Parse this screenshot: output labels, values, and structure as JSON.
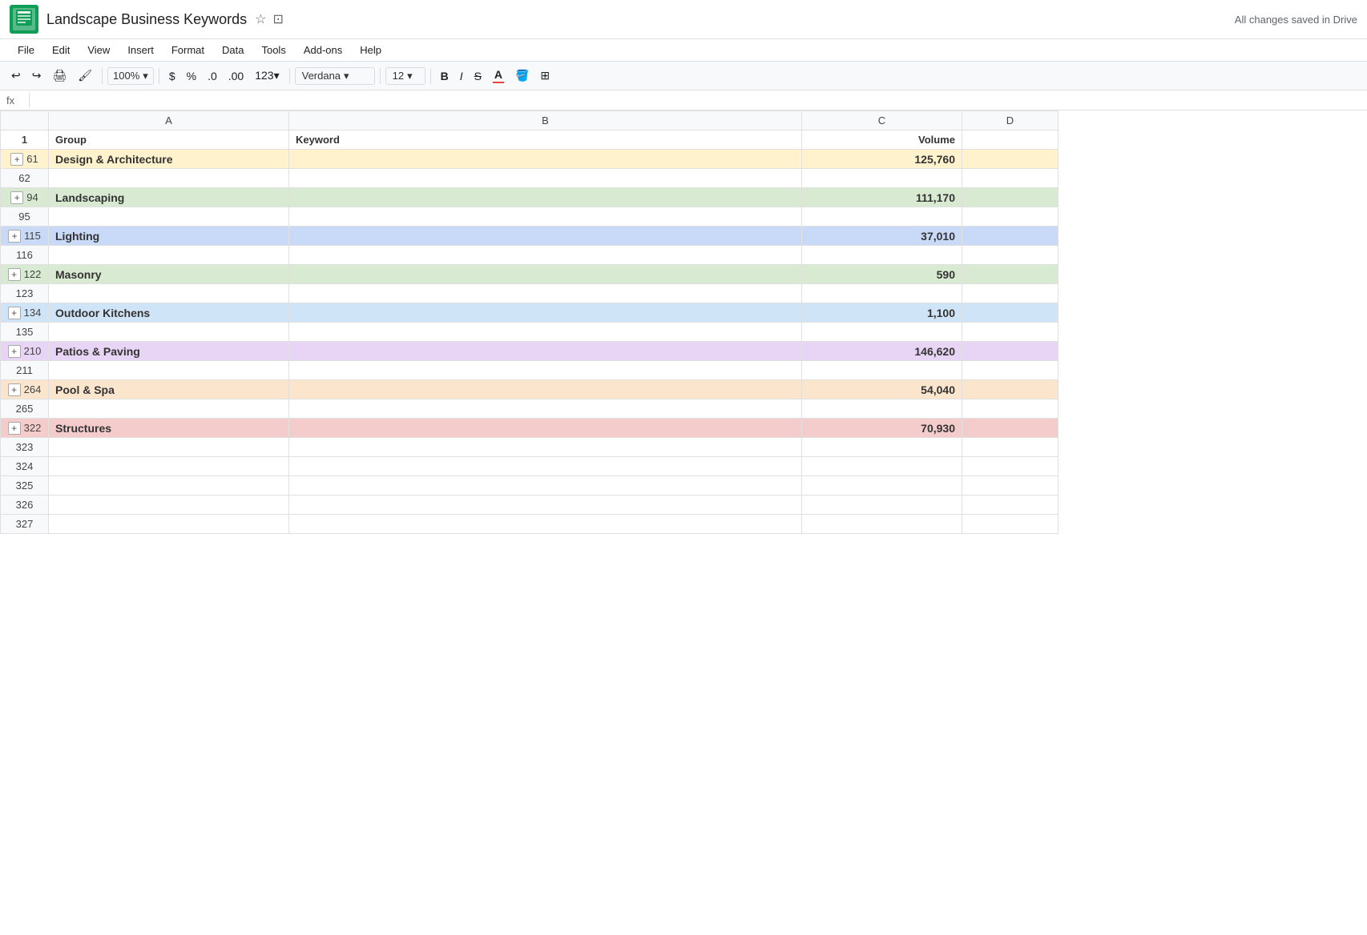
{
  "titleBar": {
    "appIcon": "≡",
    "docTitle": "Landscape Business Keywords",
    "savedText": "All changes saved in Drive"
  },
  "menuBar": {
    "items": [
      "File",
      "Edit",
      "View",
      "Insert",
      "Format",
      "Data",
      "Tools",
      "Add-ons",
      "Help"
    ]
  },
  "toolbar": {
    "zoom": "100%",
    "fontFamily": "Verdana",
    "fontSize": "12",
    "formatSymbols": [
      "$",
      "%",
      ".0",
      ".00",
      "123▾"
    ]
  },
  "formulaBar": {
    "label": "fx"
  },
  "spreadsheet": {
    "columns": [
      {
        "id": "row-num",
        "label": ""
      },
      {
        "id": "A",
        "label": "A"
      },
      {
        "id": "B",
        "label": "B"
      },
      {
        "id": "C",
        "label": "C"
      },
      {
        "id": "D",
        "label": "D"
      }
    ],
    "headerRow": {
      "rowNum": "1",
      "colA": "Group",
      "colB": "Keyword",
      "colC": "Volume"
    },
    "rows": [
      {
        "rowNum": "61",
        "group": "Design & Architecture",
        "keyword": "",
        "volume": "125,760",
        "color": "design",
        "hasExpand": true
      },
      {
        "rowNum": "62",
        "group": "",
        "keyword": "",
        "volume": "",
        "color": "",
        "hasExpand": false
      },
      {
        "rowNum": "94",
        "group": "Landscaping",
        "keyword": "",
        "volume": "111,170",
        "color": "landscaping",
        "hasExpand": true
      },
      {
        "rowNum": "95",
        "group": "",
        "keyword": "",
        "volume": "",
        "color": "",
        "hasExpand": false
      },
      {
        "rowNum": "115",
        "group": "Lighting",
        "keyword": "",
        "volume": "37,010",
        "color": "lighting",
        "hasExpand": true
      },
      {
        "rowNum": "116",
        "group": "",
        "keyword": "",
        "volume": "",
        "color": "",
        "hasExpand": false
      },
      {
        "rowNum": "122",
        "group": "Masonry",
        "keyword": "",
        "volume": "590",
        "color": "masonry",
        "hasExpand": true
      },
      {
        "rowNum": "123",
        "group": "",
        "keyword": "",
        "volume": "",
        "color": "",
        "hasExpand": false
      },
      {
        "rowNum": "134",
        "group": "Outdoor Kitchens",
        "keyword": "",
        "volume": "1,100",
        "color": "outdoor",
        "hasExpand": true
      },
      {
        "rowNum": "135",
        "group": "",
        "keyword": "",
        "volume": "",
        "color": "",
        "hasExpand": false
      },
      {
        "rowNum": "210",
        "group": "Patios & Paving",
        "keyword": "",
        "volume": "146,620",
        "color": "patios",
        "hasExpand": true
      },
      {
        "rowNum": "211",
        "group": "",
        "keyword": "",
        "volume": "",
        "color": "",
        "hasExpand": false
      },
      {
        "rowNum": "264",
        "group": "Pool & Spa",
        "keyword": "",
        "volume": "54,040",
        "color": "pool",
        "hasExpand": true
      },
      {
        "rowNum": "265",
        "group": "",
        "keyword": "",
        "volume": "",
        "color": "",
        "hasExpand": false
      },
      {
        "rowNum": "322",
        "group": "Structures",
        "keyword": "",
        "volume": "70,930",
        "color": "structures",
        "hasExpand": true
      },
      {
        "rowNum": "323",
        "group": "",
        "keyword": "",
        "volume": "",
        "color": "",
        "hasExpand": false
      },
      {
        "rowNum": "324",
        "group": "",
        "keyword": "",
        "volume": "",
        "color": "",
        "hasExpand": false
      },
      {
        "rowNum": "325",
        "group": "",
        "keyword": "",
        "volume": "",
        "color": "",
        "hasExpand": false
      },
      {
        "rowNum": "326",
        "group": "",
        "keyword": "",
        "volume": "",
        "color": "",
        "hasExpand": false
      },
      {
        "rowNum": "327",
        "group": "",
        "keyword": "",
        "volume": "",
        "color": "",
        "hasExpand": false
      }
    ],
    "colorMap": {
      "design": "#fff2cc",
      "landscaping": "#d9ead3",
      "lighting": "#c9daf8",
      "masonry": "#d9ead3",
      "outdoor": "#d0e4f7",
      "patios": "#e8d5f5",
      "pool": "#fce5cd",
      "structures": "#f4cccc"
    }
  }
}
